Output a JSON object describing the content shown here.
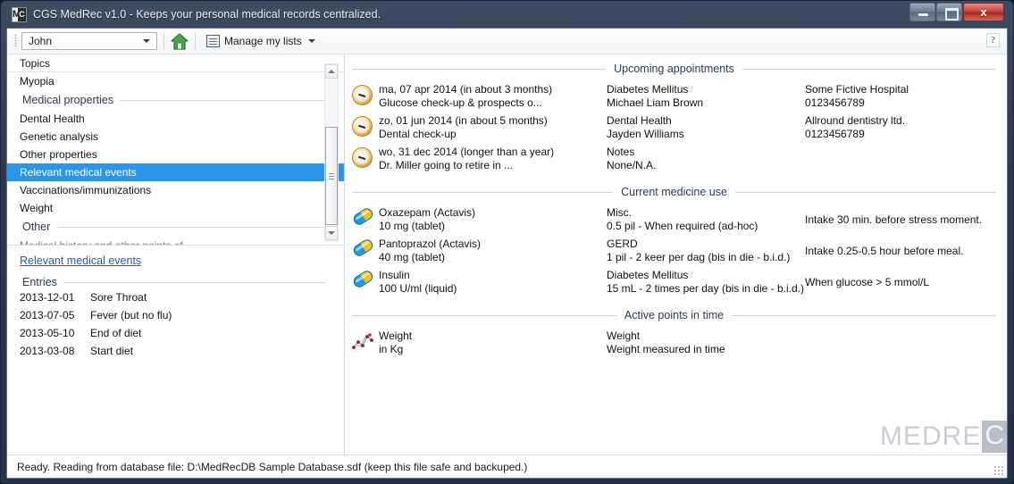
{
  "window": {
    "title": "CGS MedRec v1.0 - Keeps your personal medical records centralized.",
    "app_icon_m": "M",
    "app_icon_c": "C",
    "minimize_label": "Minimize",
    "maximize_label": "Maximize",
    "close_label": "x"
  },
  "toolbar": {
    "person_value": "John",
    "home_icon_label": "home-icon",
    "manage_lists_label": "Manage my lists",
    "help_label": "?"
  },
  "sidebar": {
    "list_header": "Topics",
    "items": [
      {
        "label": "Myopia",
        "type": "item",
        "selected": false
      },
      {
        "label": "Medical properties",
        "type": "group"
      },
      {
        "label": "Dental Health",
        "type": "item",
        "selected": false
      },
      {
        "label": "Genetic analysis",
        "type": "item",
        "selected": false
      },
      {
        "label": "Other properties",
        "type": "item",
        "selected": false
      },
      {
        "label": "Relevant medical events",
        "type": "item",
        "selected": true
      },
      {
        "label": "Vaccinations/immunizations",
        "type": "item",
        "selected": false
      },
      {
        "label": "Weight",
        "type": "item",
        "selected": false
      },
      {
        "label": "Other",
        "type": "group"
      },
      {
        "label": "Medical history and other points of...",
        "type": "clipped"
      }
    ]
  },
  "detail": {
    "title_link": "Relevant medical events",
    "entries_group": "Entries",
    "entries": [
      {
        "date": "2013-12-01",
        "text": "Sore Throat"
      },
      {
        "date": "2013-07-05",
        "text": "Fever (but no flu)"
      },
      {
        "date": "2013-05-10",
        "text": "End of diet"
      },
      {
        "date": "2013-03-08",
        "text": "Start diet"
      }
    ]
  },
  "appointments": {
    "heading": "Upcoming appointments",
    "rows": [
      {
        "icon": "clock-icon",
        "when": "ma, 07 apr 2014 (in about 3 months)",
        "what": "Glucose check-up & prospects o...",
        "topic": "Diabetes Mellitus",
        "person": "Michael Liam Brown",
        "place": "Some Fictive Hospital",
        "phone": "0123456789"
      },
      {
        "icon": "clock-icon",
        "when": "zo, 01 jun 2014 (in about 5 months)",
        "what": "Dental check-up",
        "topic": "Dental Health",
        "person": "Jayden Williams",
        "place": "Allround dentistry ltd.",
        "phone": "0123456789"
      },
      {
        "icon": "clock-icon",
        "when": "wo, 31 dec 2014 (longer than a year)",
        "what": "Dr. Miller going to retire in ...",
        "topic": "Notes",
        "person": "None/N.A.",
        "place": "",
        "phone": ""
      }
    ]
  },
  "medicine": {
    "heading": "Current medicine use",
    "rows": [
      {
        "icon": "capsule-icon",
        "name": "Oxazepam (Actavis)",
        "dose": "10 mg (tablet)",
        "topic": "Misc.",
        "schedule": "0.5 pil - When required (ad-hoc)",
        "note": "Intake 30 min. before stress moment."
      },
      {
        "icon": "capsule-icon",
        "name": "Pantoprazol (Actavis)",
        "dose": "40 mg (tablet)",
        "topic": "GERD",
        "schedule": "1 pil - 2 keer per dag (bis in die - b.i.d.)",
        "note": "Intake 0.25-0.5 hour before meal."
      },
      {
        "icon": "capsule-icon",
        "name": "Insulin",
        "dose": "100 U/ml (liquid)",
        "topic": "Diabetes Mellitus",
        "schedule": "15 mL - 2 times per day (bis in die - b.i.d.)",
        "note": "When glucose > 5 mmol/L"
      }
    ]
  },
  "points_in_time": {
    "heading": "Active points in time",
    "rows": [
      {
        "icon": "scatter-chart-icon",
        "name": "Weight",
        "unit": "in Kg",
        "topic": "Weight",
        "description": "Weight measured in time"
      }
    ]
  },
  "watermark": {
    "text": "MEDRE",
    "boxed": "C"
  },
  "statusbar": {
    "text": "Ready. Reading from database file: D:\\MedRecDB Sample Database.sdf (keep this file safe and backuped.)"
  },
  "colors": {
    "selection_blue": "#2b96e8",
    "section_heading": "#2b3a55",
    "link_blue": "#1f5fa8",
    "close_red": "#c2453a",
    "pill_blue": "#1f9ad6",
    "pill_yellow": "#f2c416"
  }
}
